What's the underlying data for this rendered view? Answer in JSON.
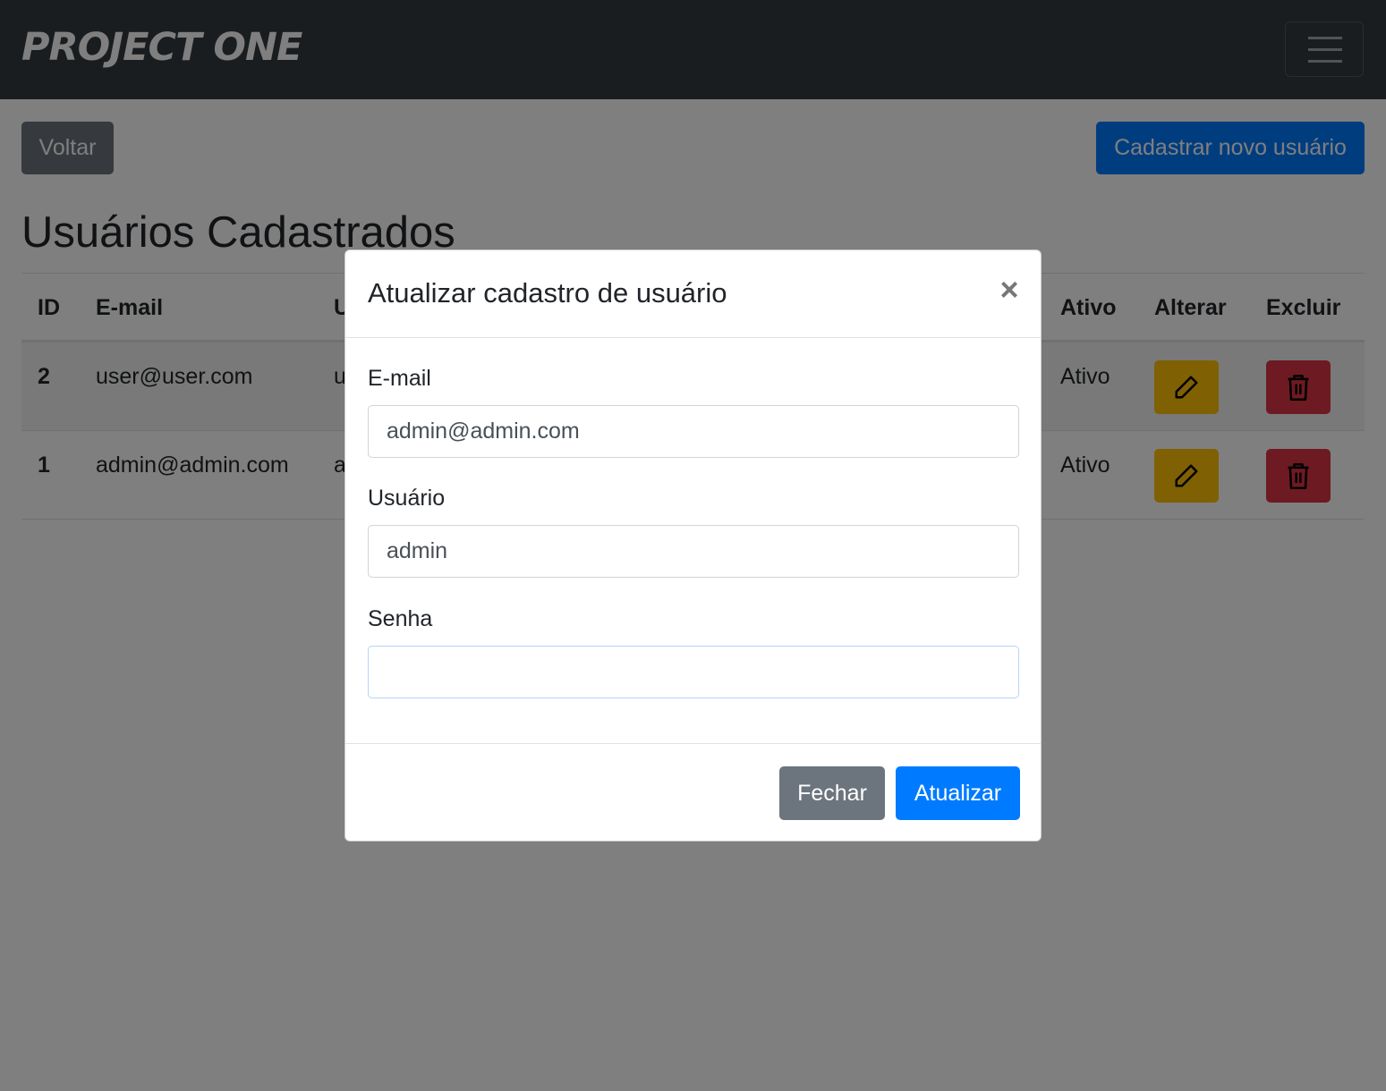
{
  "navbar": {
    "brand": "PROJECT ONE",
    "toggler_icon": "hamburger-menu-icon"
  },
  "toolbar": {
    "back_label": "Voltar",
    "new_user_label": "Cadastrar novo usuário"
  },
  "page": {
    "title": "Usuários Cadastrados"
  },
  "table": {
    "headers": {
      "id": "ID",
      "email": "E-mail",
      "user": "U",
      "active": "Ativo",
      "edit": "Alterar",
      "delete": "Excluir"
    },
    "rows": [
      {
        "id": "2",
        "email": "user@user.com",
        "user": "u",
        "active": "Ativo"
      },
      {
        "id": "1",
        "email": "admin@admin.com",
        "user": "a",
        "active": "Ativo"
      }
    ],
    "edit_icon": "pencil-icon",
    "delete_icon": "trash-icon"
  },
  "modal": {
    "title": "Atualizar cadastro de usuário",
    "close_symbol": "×",
    "email_label": "E-mail",
    "email_value": "admin@admin.com",
    "user_label": "Usuário",
    "user_value": "admin",
    "password_label": "Senha",
    "password_value": "",
    "close_button": "Fechar",
    "update_button": "Atualizar"
  },
  "colors": {
    "navbar": "#343a40",
    "primary": "#007bff",
    "secondary": "#6c757d",
    "warning": "#ffc107",
    "danger": "#dc3545",
    "backdrop": "rgba(0,0,0,0.5)"
  }
}
